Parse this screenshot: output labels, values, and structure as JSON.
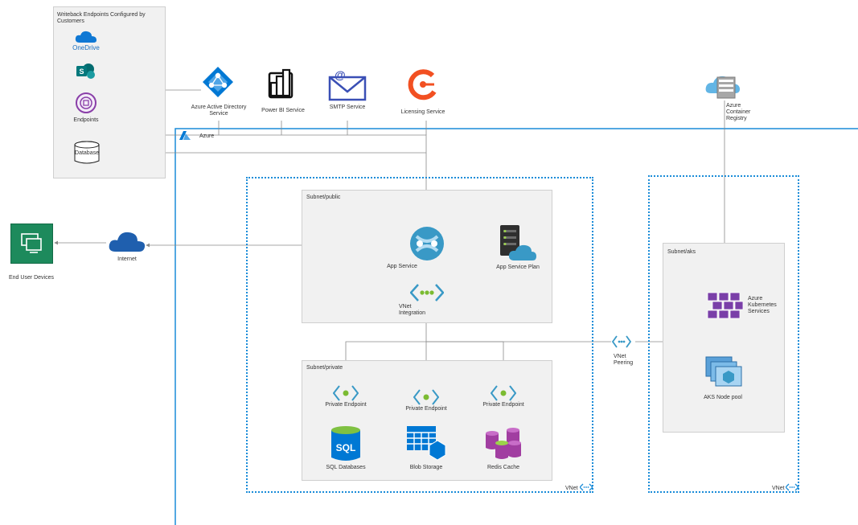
{
  "writeback": {
    "title": "Writeback Endpoints Configured by Customers",
    "items": {
      "onedrive": "OneDrive",
      "endpoints": "Endpoints",
      "database": "Database"
    }
  },
  "top_services": {
    "aad": "Azure Active Directory Service",
    "powerbi": "Power BI Service",
    "smtp": "SMTP Service",
    "licensing": "Licensing Service",
    "acr": "Azure Container Registry"
  },
  "azure": {
    "label": "Azure"
  },
  "subnet_public": {
    "label": "Subnet/public",
    "app_service": "App Service",
    "app_service_plan": "App Service Plan",
    "vnet_integration": "VNet Integration"
  },
  "subnet_private": {
    "label": "Subnet/private",
    "pe_sql": "Private Endpoint",
    "pe_blob": "Private Endpoint",
    "pe_redis": "Private Endpoint",
    "sql": "SQL Databases",
    "blob": "Blob Storage",
    "redis": "Redis Cache"
  },
  "subnet_aks": {
    "label": "Subnet/aks",
    "aks": "Azure Kubernetes Services",
    "nodepool": "AKS Node pool"
  },
  "vnet_left": {
    "label": "VNet"
  },
  "vnet_right": {
    "label": "VNet"
  },
  "vnet_peering": "VNet Peering",
  "internet": "Internet",
  "end_user": "End User Devices",
  "colors": {
    "azure_blue": "#1a8cd8",
    "purple": "#8a3fa8",
    "green": "#107c41",
    "orange": "#f25022",
    "line": "#8a8a8a"
  }
}
